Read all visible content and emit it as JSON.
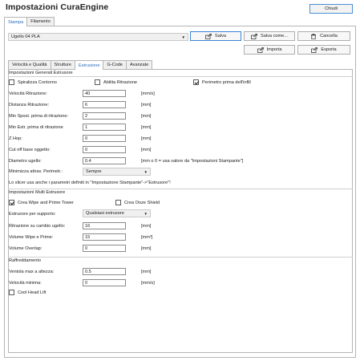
{
  "window": {
    "title": "Impostazioni CuraEngine",
    "close_label": "Chiudi"
  },
  "top_tabs": [
    {
      "label": "Stampa",
      "active": true
    },
    {
      "label": "Filamento",
      "active": false
    }
  ],
  "profile": {
    "selected": "Ugello 04 PLA",
    "buttons": {
      "save": "Salva",
      "save_as": "Salva come...",
      "delete": "Cancella",
      "import": "Importa",
      "export": "Esporta"
    }
  },
  "sub_tabs": [
    {
      "label": "Velocità e Qualità",
      "active": false
    },
    {
      "label": "Strutture",
      "active": false
    },
    {
      "label": "Estrusione",
      "active": true
    },
    {
      "label": "G-Code",
      "active": false
    },
    {
      "label": "Avanzate",
      "active": false
    }
  ],
  "general": {
    "title": "Impostazioni Generali Estrusore",
    "spiralize": {
      "label": "Spiralizza Contorno",
      "checked": false
    },
    "enable_retraction": {
      "label": "Abilita Ritrazione",
      "checked": false
    },
    "perimeter_first": {
      "label": "Perimetro prima dell'infill",
      "checked": true
    },
    "fields": [
      {
        "label": "Velocità Ritrazione:",
        "value": "40",
        "unit": "[mm/s]"
      },
      {
        "label": "Distanza Ritrazione:",
        "value": "6",
        "unit": "[mm]"
      },
      {
        "label": "Min Spost. prima di ritrazione:",
        "value": "2",
        "unit": "[mm]"
      },
      {
        "label": "Min Estr. prima di ritrazione",
        "value": "1",
        "unit": "[mm]"
      },
      {
        "label": "Z Hop:",
        "value": "0",
        "unit": "[mm]"
      },
      {
        "label": "Cut off base oggetto:",
        "value": "0",
        "unit": "[mm]"
      },
      {
        "label": "Diametro ugello:",
        "value": "0.4",
        "unit": "[mm o 0 = usa valore da \"Impostazioni Stampante\"]"
      }
    ],
    "minimize": {
      "label": "Minimizza attrav. Perimetr.:",
      "value": "Sempre"
    },
    "note": "Lo slicer usa anche i parametri definiti in \"Impostazione Stampante\"->\"Estrusore\"!"
  },
  "multi": {
    "title": "Impostazioni Multi Estrusore",
    "wipe_tower": {
      "label": "Crea Wipe and Prime Tower",
      "checked": true
    },
    "ooze_shield": {
      "label": "Crea Ooze Shield",
      "checked": false
    },
    "support_extruder": {
      "label": "Estrusore per supporto:",
      "value": "Qualsiasi estrusore"
    },
    "fields": [
      {
        "label": "Ritrazione su cambio ugello:",
        "value": "16",
        "unit": "[mm]"
      },
      {
        "label": "Volume Wipe e Prime:",
        "value": "15",
        "unit": "[mm³]"
      },
      {
        "label": "Volume Overlap:",
        "value": "0",
        "unit": "[mm]"
      }
    ]
  },
  "cooling": {
    "title": "Raffreddamento",
    "fields": [
      {
        "label": "Ventola max a altezza:",
        "value": "0.5",
        "unit": "[mm]"
      },
      {
        "label": "Velocità minima:",
        "value": "0",
        "unit": "[mm/s]"
      }
    ],
    "cool_head_lift": {
      "label": "Cool Head Lift",
      "checked": false
    }
  },
  "colors": {
    "accent": "#2a6ebd",
    "button_border": "#3a84d4",
    "panel_border": "#b5b5b5"
  }
}
